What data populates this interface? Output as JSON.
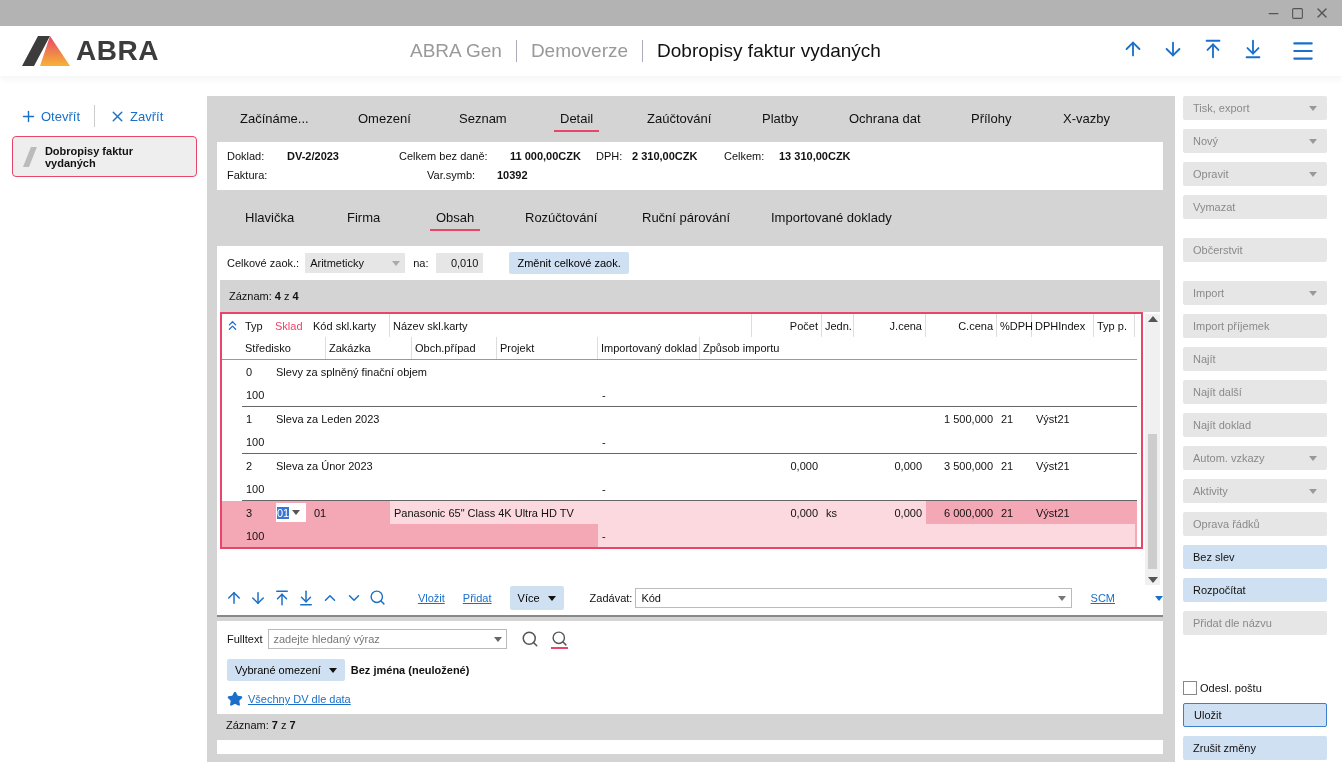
{
  "header": {
    "logo": "ABRA",
    "breadcrumbs": [
      "ABRA Gen",
      "Demoverze"
    ],
    "title": "Dobropisy faktur vydaných"
  },
  "left_panel": {
    "actions": [
      "Otevřít",
      "Zavřít"
    ],
    "items": [
      {
        "label": "Dobropisy faktur vydaných",
        "selected": true
      }
    ]
  },
  "tabs": [
    {
      "label": "Začínáme...",
      "selected": false
    },
    {
      "label": "Omezení",
      "selected": false
    },
    {
      "label": "Seznam",
      "selected": false
    },
    {
      "label": "Detail",
      "selected": true
    },
    {
      "label": "Zaúčtování",
      "selected": false
    },
    {
      "label": "Platby",
      "selected": false
    },
    {
      "label": "Ochrana dat",
      "selected": false
    },
    {
      "label": "Přílohy",
      "selected": false
    },
    {
      "label": "X-vazby",
      "selected": false
    }
  ],
  "summary": {
    "rows": [
      [
        {
          "label": "Doklad:",
          "value": "DV-2/2023"
        },
        {
          "label": "Celkem bez daně:",
          "value": "11 000,00CZK"
        },
        {
          "label": "DPH:",
          "value": "2 310,00CZK"
        },
        {
          "label": "Celkem:",
          "value": "13 310,00CZK"
        }
      ],
      [
        {
          "label": "Faktura:"
        },
        {
          "label": "Var.symb:",
          "value": "10392"
        }
      ]
    ]
  },
  "subtabs": [
    {
      "label": "Hlavička",
      "selected": false
    },
    {
      "label": "Firma",
      "selected": false
    },
    {
      "label": "Obsah",
      "selected": true
    },
    {
      "label": "Rozúčtování",
      "selected": false
    },
    {
      "label": "Ruční párování",
      "selected": false
    },
    {
      "label": "Importované doklady",
      "selected": false
    }
  ],
  "rounding": {
    "label": "Celkové zaok.:",
    "mode": "Aritmeticky",
    "to_label": "na:",
    "to_value": "0,010",
    "button": "Změnit celkové zaok."
  },
  "record_counter": "Záznam: **4** z **4**",
  "table": {
    "columns_line1": [
      {
        "label": "Typ",
        "active": false
      },
      {
        "label": "Sklad",
        "active": true
      },
      {
        "label": "Kód skl.karty",
        "active": false
      },
      {
        "label": "Název skl.karty",
        "active": false
      },
      {
        "label": "Počet",
        "active": false
      },
      {
        "label": "Jedn.",
        "active": false
      },
      {
        "label": "J.cena",
        "active": false
      },
      {
        "label": "C.cena",
        "active": false
      },
      {
        "label": "%DPH",
        "active": false
      },
      {
        "label": "DPHIndex",
        "active": false
      },
      {
        "label": "Typ p.",
        "active": false
      }
    ],
    "columns_line2": [
      {
        "label": "Středisko",
        "active": false
      },
      {
        "label": "Zakázka",
        "active": false
      },
      {
        "label": "Obch.případ",
        "active": false
      },
      {
        "label": "Projekt",
        "active": false
      },
      {
        "label": "Importovaný doklad",
        "active": false
      },
      {
        "label": "Způsob importu",
        "active": false
      }
    ],
    "rows": [
      {
        "selected": false,
        "line1": [
          {
            "kind": "type",
            "text": "0"
          },
          {
            "kind": "description",
            "text": "Slevy za splněný finační objem"
          }
        ],
        "line2": [
          {
            "kind": "centre",
            "text": "100"
          },
          {
            "kind": "import",
            "text": "-"
          }
        ]
      },
      {
        "selected": false,
        "line1": [
          {
            "kind": "type",
            "text": "1"
          },
          {
            "kind": "description",
            "text": "Sleva za Leden 2023"
          },
          {
            "kind": "total",
            "text": "1 500,000"
          },
          {
            "kind": "vat",
            "text": "21"
          },
          {
            "kind": "vatindex",
            "text": "Výst21"
          }
        ],
        "line2": [
          {
            "kind": "centre",
            "text": "100"
          },
          {
            "kind": "import",
            "text": "-"
          }
        ]
      },
      {
        "selected": false,
        "line1": [
          {
            "kind": "type",
            "text": "2"
          },
          {
            "kind": "description",
            "text": "Sleva za Únor 2023"
          },
          {
            "kind": "count",
            "text": "0,000"
          },
          {
            "kind": "price",
            "text": "0,000"
          },
          {
            "kind": "total",
            "text": "3 500,000"
          },
          {
            "kind": "vat",
            "text": "21"
          },
          {
            "kind": "vatindex",
            "text": "Výst21"
          }
        ],
        "line2": [
          {
            "kind": "centre",
            "text": "100"
          },
          {
            "kind": "import",
            "text": "-"
          }
        ]
      },
      {
        "selected": true,
        "line1": [
          {
            "kind": "type",
            "text": "3",
            "editable": false
          },
          {
            "kind": "warehouse",
            "text": "01"
          },
          {
            "kind": "code",
            "text": "01",
            "editable": false
          },
          {
            "kind": "name",
            "text": "Panasonic 65\" Class 4K Ultra HD TV",
            "editable": true
          },
          {
            "kind": "count",
            "text": "0,000",
            "editable": true
          },
          {
            "kind": "unit",
            "text": "ks",
            "editable": true
          },
          {
            "kind": "price",
            "text": "0,000",
            "editable": true
          },
          {
            "kind": "total",
            "text": "6 000,000",
            "editable": false
          },
          {
            "kind": "vat",
            "text": "21",
            "editable": false
          },
          {
            "kind": "vatindex",
            "text": "Výst21",
            "editable": false
          }
        ],
        "line2": [
          {
            "kind": "centre",
            "text": "100",
            "editable": false
          },
          {
            "kind": "import",
            "text": "-",
            "editable": true
          }
        ]
      }
    ]
  },
  "toolbar": {
    "links": [
      "Vložit",
      "Přidat"
    ],
    "more": "Více",
    "input_label": "Zadávat:",
    "input_value": "Kód",
    "scm": "SCM"
  },
  "filter": {
    "fulltext": {
      "label": "Fulltext",
      "placeholder": "zadejte hledaný výraz"
    },
    "restriction": "Vybrané omezení",
    "restriction_name": "Bez jména (neuložené)",
    "favorite": "Všechny DV dle data"
  },
  "list_counter": "Záznam: **7** z **7**",
  "actions": {
    "groups": [
      [
        {
          "label": "Tisk, export",
          "disabled": true,
          "dropdown": true
        },
        {
          "label": "Nový",
          "disabled": true,
          "dropdown": true
        },
        {
          "label": "Opravit",
          "disabled": true,
          "dropdown": true
        },
        {
          "label": "Vymazat",
          "disabled": true,
          "dropdown": false
        }
      ],
      [
        {
          "label": "Občerstvit",
          "disabled": true,
          "dropdown": false
        }
      ],
      [
        {
          "label": "Import",
          "disabled": true,
          "dropdown": true
        },
        {
          "label": "Import příjemek",
          "disabled": true,
          "dropdown": false
        },
        {
          "label": "Najít",
          "disabled": true,
          "dropdown": false
        },
        {
          "label": "Najít další",
          "disabled": true,
          "dropdown": false
        },
        {
          "label": "Najít doklad",
          "disabled": true,
          "dropdown": false
        },
        {
          "label": "Autom. vzkazy",
          "disabled": true,
          "dropdown": true
        },
        {
          "label": "Aktivity",
          "disabled": true,
          "dropdown": true
        },
        {
          "label": "Oprava řádků",
          "disabled": true,
          "dropdown": false
        },
        {
          "label": "Bez slev",
          "disabled": false,
          "dropdown": false
        },
        {
          "label": "Rozpočítat",
          "disabled": false,
          "dropdown": false
        },
        {
          "label": "Přidat dle názvu",
          "disabled": true,
          "dropdown": false
        }
      ]
    ],
    "checkbox": {
      "label": "Odesl. poštu",
      "checked": false
    },
    "bottom": [
      {
        "label": "Uložit",
        "focused": true
      },
      {
        "label": "Zrušit změny",
        "focused": false
      }
    ]
  }
}
